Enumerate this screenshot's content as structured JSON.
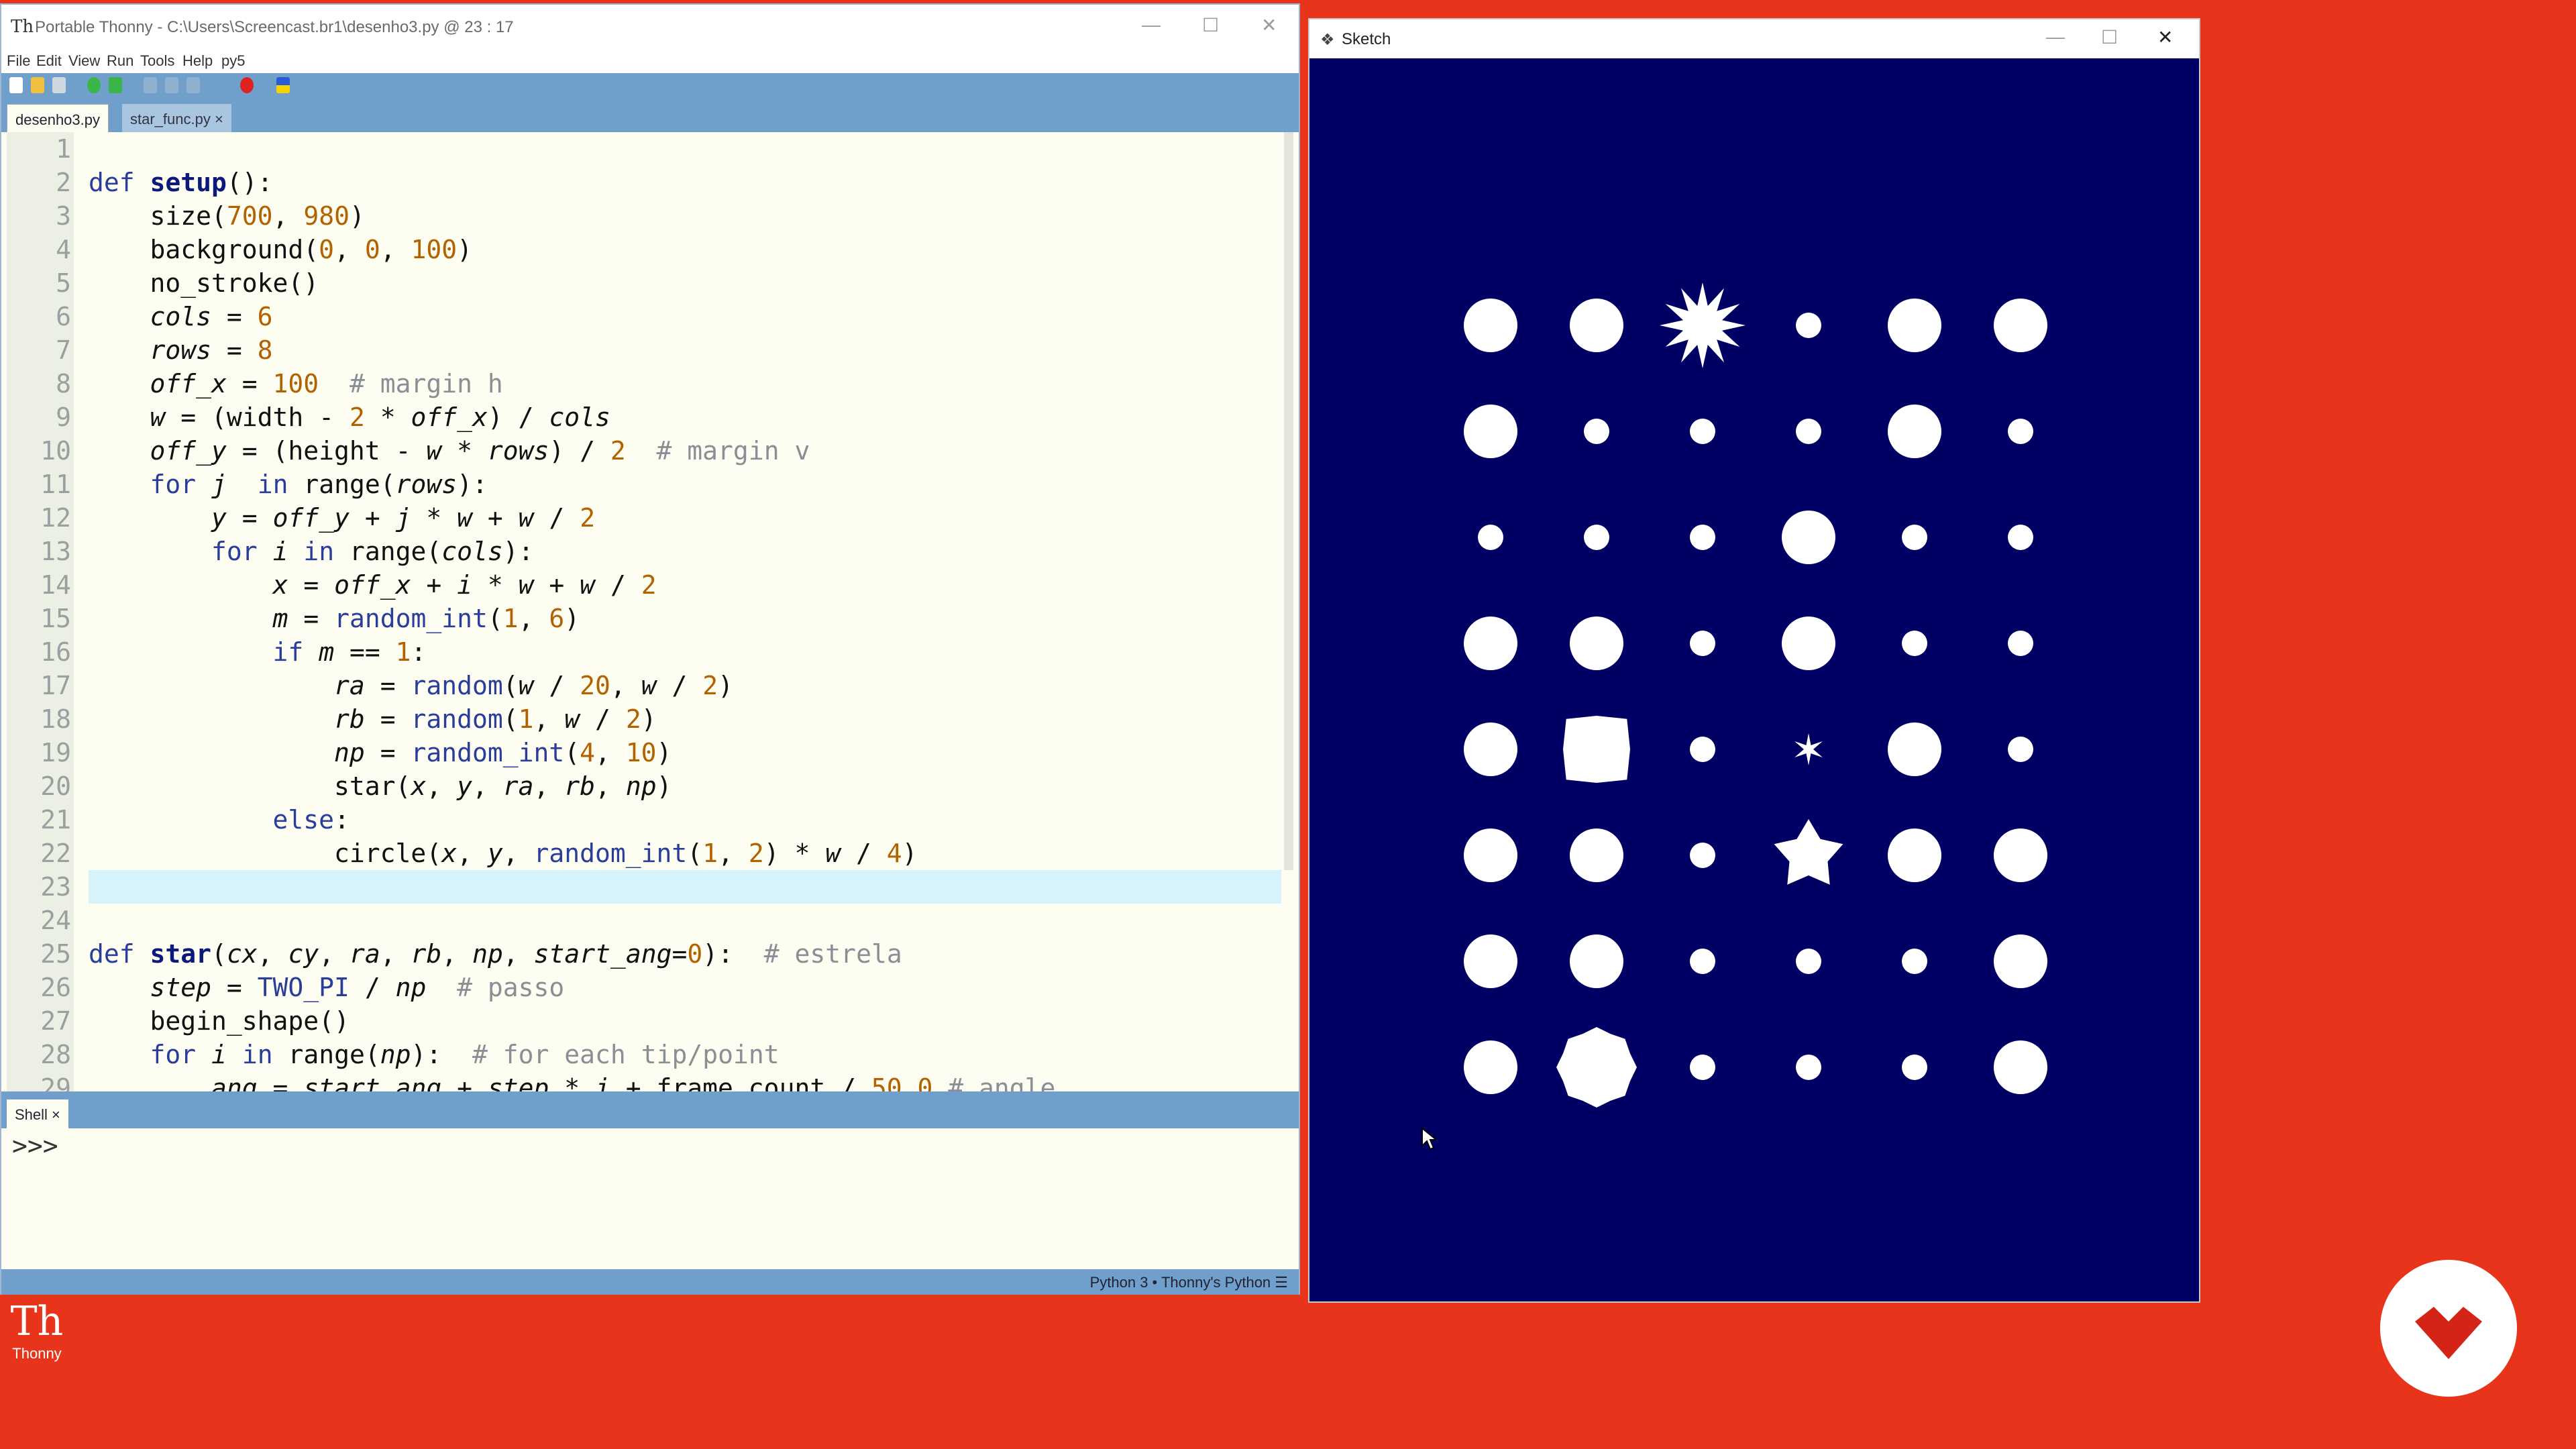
{
  "thonny": {
    "title": "Portable Thonny  -  C:\\Users\\Screencast.br1\\desenho3.py  @  23 : 17",
    "menu": [
      "File",
      "Edit",
      "View",
      "Run",
      "Tools",
      "Help",
      "py5"
    ],
    "tabs": [
      {
        "label": "desenho3.py",
        "active": true
      },
      {
        "label": "star_func.py",
        "active": false
      }
    ],
    "line_numbers": [
      "1",
      "2",
      "3",
      "4",
      "5",
      "6",
      "7",
      "8",
      "9",
      "10",
      "11",
      "12",
      "13",
      "14",
      "15",
      "16",
      "17",
      "18",
      "19",
      "20",
      "21",
      "22",
      "23",
      "24",
      "25",
      "26",
      "27",
      "28",
      "29"
    ],
    "current_line": 23,
    "shell_tab": "Shell",
    "shell_prompt": ">>>",
    "status": "Python 3  •  Thonny's Python  ☰"
  },
  "sketch": {
    "title": "Sketch",
    "background_color": "#000064",
    "grid": {
      "cols": 6,
      "rows": 8
    },
    "shapes": [
      [
        "big",
        "big",
        "star12",
        "small",
        "big",
        "big"
      ],
      [
        "big",
        "small",
        "small",
        "small",
        "big",
        "small"
      ],
      [
        "small",
        "small",
        "small",
        "big",
        "small",
        "small"
      ],
      [
        "big",
        "big",
        "small",
        "big",
        "small",
        "small"
      ],
      [
        "big",
        "square",
        "small",
        "star6",
        "big",
        "small"
      ],
      [
        "big",
        "big",
        "small",
        "star5",
        "big",
        "big"
      ],
      [
        "big",
        "big",
        "small",
        "small",
        "small",
        "big"
      ],
      [
        "big",
        "octagon",
        "small",
        "small",
        "small",
        "big"
      ]
    ]
  },
  "desktop": {
    "icon_label": "Thonny"
  },
  "colors": {
    "desktop": "#e8341a",
    "thonny_chrome": "#6f9fca",
    "editor_bg": "#fdfdf2",
    "current_line": "#d6f2fb"
  }
}
